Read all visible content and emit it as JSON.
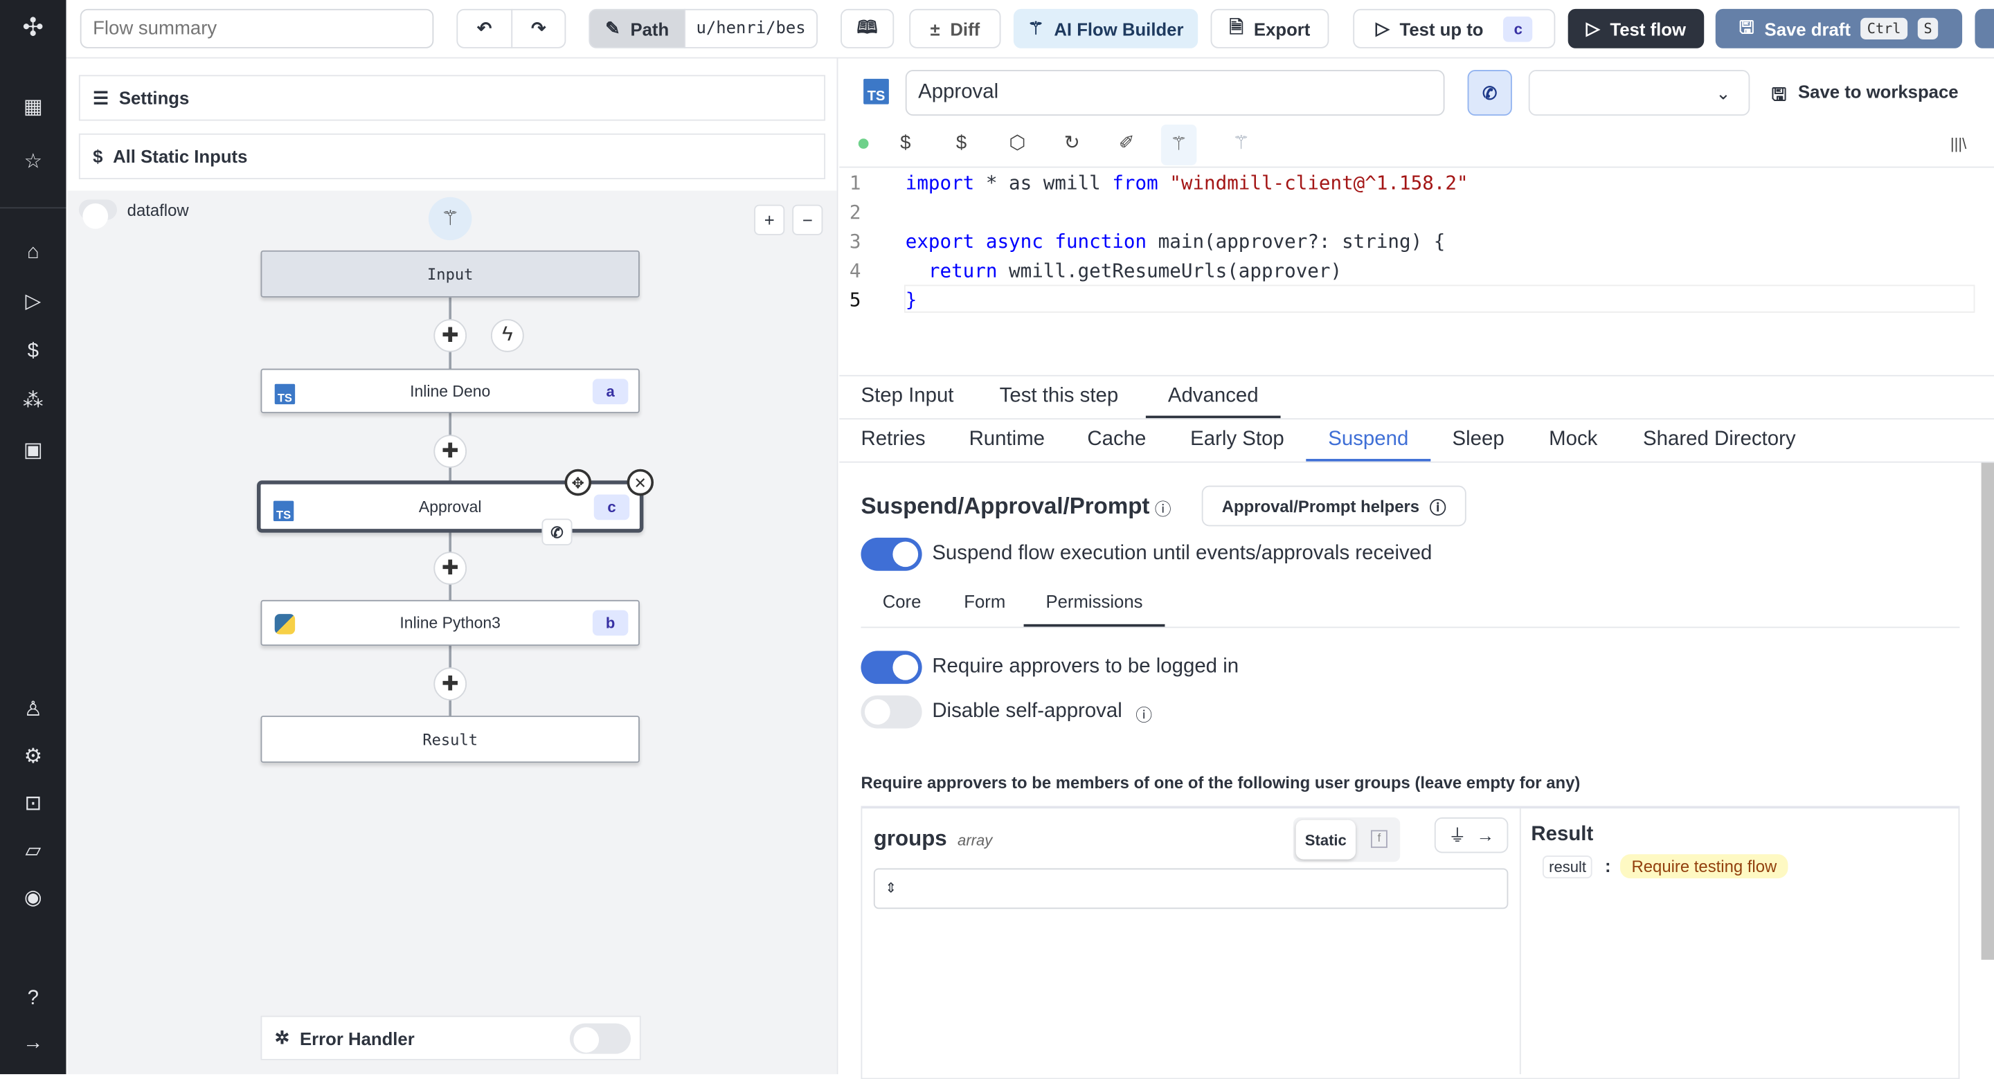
{
  "topbar": {
    "summary_placeholder": "Flow summary",
    "path_label": "Path",
    "path_value": "u/henri/bes",
    "diff": "Diff",
    "ai_flow_builder": "AI Flow Builder",
    "export": "Export",
    "test_up_to": "Test up to",
    "test_up_to_badge": "c",
    "test_flow": "Test flow",
    "save_draft": "Save draft",
    "kbd_ctrl": "Ctrl",
    "kbd_s": "S"
  },
  "left": {
    "settings": "Settings",
    "static_inputs": "All Static Inputs",
    "dataflow": "dataflow",
    "nodes": [
      {
        "label": "Input"
      },
      {
        "label": "Inline Deno",
        "badge": "a"
      },
      {
        "label": "Approval",
        "badge": "c"
      },
      {
        "label": "Inline Python3",
        "badge": "b"
      },
      {
        "label": "Result"
      }
    ],
    "error_handler": "Error Handler"
  },
  "editor": {
    "step_name": "Approval",
    "save_to_workspace": "Save to workspace",
    "lines": [
      "1",
      "2",
      "3",
      "4",
      "5"
    ],
    "code": {
      "l1a": "import",
      "l1b": " * as wmill ",
      "l1c": "from",
      "l1d": " ",
      "l1e": "\"windmill-client@^1.158.2\"",
      "l3a": "export async function",
      "l3b": " main(approver?: string) {",
      "l4a": "  return",
      "l4b": " wmill.getResumeUrls(approver)",
      "l5": "}"
    }
  },
  "tabs": {
    "row1": [
      "Step Input",
      "Test this step",
      "Advanced"
    ],
    "row2": [
      "Retries",
      "Runtime",
      "Cache",
      "Early Stop",
      "Suspend",
      "Sleep",
      "Mock",
      "Shared Directory"
    ]
  },
  "suspend": {
    "title": "Suspend/Approval/Prompt",
    "helpers": "Approval/Prompt helpers",
    "suspend_toggle": "Suspend flow execution until events/approvals received",
    "subtabs": [
      "Core",
      "Form",
      "Permissions"
    ],
    "require_login": "Require approvers to be logged in",
    "disable_self": "Disable self-approval",
    "groups_label": "Require approvers to be members of one of the following user groups (leave empty for any)",
    "groups": "groups",
    "groups_type": "array",
    "static": "Static",
    "result_title": "Result",
    "result_key": "result",
    "result_value": "Require testing flow"
  },
  "colors": {
    "accent": "#3f6fd6",
    "sidebar": "#1f2228",
    "save_draft": "#6580a8",
    "test_flow": "#2d333e"
  }
}
